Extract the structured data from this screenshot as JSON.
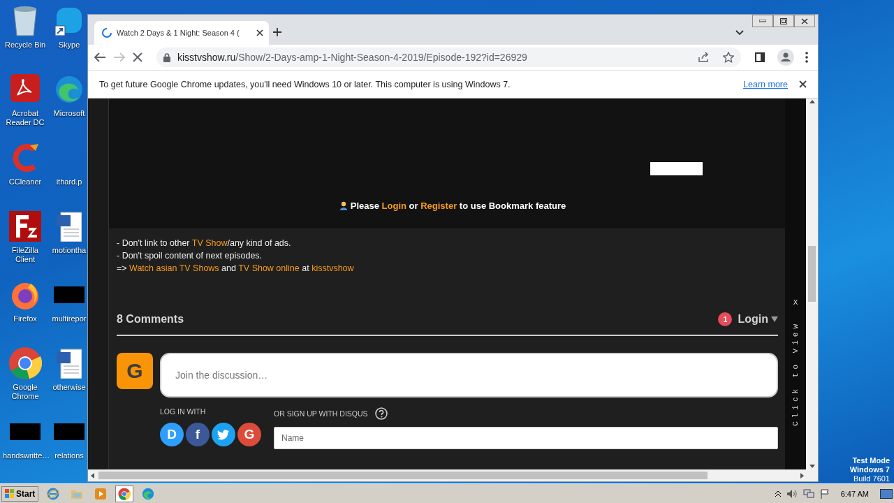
{
  "desktop": {
    "icons": [
      {
        "label": "Recycle Bin",
        "kind": "recycle"
      },
      {
        "label": "Skype",
        "kind": "skype"
      },
      {
        "label": "Acrobat Reader DC",
        "kind": "acrobat"
      },
      {
        "label": "Microsoft",
        "kind": "edge"
      },
      {
        "label": "CCleaner",
        "kind": "ccleaner"
      },
      {
        "label": "ithard.p",
        "kind": "none"
      },
      {
        "label": "FileZilla Client",
        "kind": "filezilla"
      },
      {
        "label": "motiontha",
        "kind": "word"
      },
      {
        "label": "Firefox",
        "kind": "firefox"
      },
      {
        "label": "multirepor",
        "kind": "redacted"
      },
      {
        "label": "Google Chrome",
        "kind": "chrome"
      },
      {
        "label": "otherwise",
        "kind": "word"
      },
      {
        "label": "handswritte…",
        "kind": "redacted"
      },
      {
        "label": "relations",
        "kind": "redacted"
      }
    ],
    "system_notice": [
      "Test Mode",
      "Windows 7",
      "Build 7601"
    ]
  },
  "browser": {
    "tab": {
      "title": "Watch 2 Days & 1 Night: Season 4 (",
      "loading": true
    },
    "nav": {
      "forward_disabled": true,
      "loading": true
    },
    "address": {
      "domain": "kisstvshow.ru",
      "path": "/Show/2-Days-amp-1-Night-Season-4-2019/Episode-192?id=26929"
    },
    "infobar": {
      "text": "To get future Google Chrome updates, you'll need Windows 10 or later. This computer is using Windows 7.",
      "link": "Learn more"
    },
    "page": {
      "bookmark_notice": [
        {
          "text": "Please ",
          "link": false
        },
        {
          "text": "Login",
          "link": true
        },
        {
          "text": " or ",
          "link": false
        },
        {
          "text": "Register",
          "link": true
        },
        {
          "text": " to use Bookmark feature",
          "link": false
        }
      ],
      "rules": [
        [
          {
            "text": "- Don't link to other ",
            "link": false
          },
          {
            "text": "TV Show",
            "link": true
          },
          {
            "text": "/any kind of ads.",
            "link": false
          }
        ],
        [
          {
            "text": "- Don't spoil content of next episodes.",
            "link": false
          }
        ],
        [
          {
            "text": "=> ",
            "link": false
          },
          {
            "text": "Watch asian TV Shows",
            "link": true
          },
          {
            "text": " and ",
            "link": false
          },
          {
            "text": "TV Show online",
            "link": true
          },
          {
            "text": " at ",
            "link": false
          },
          {
            "text": "kisstvshow",
            "link": true
          }
        ]
      ],
      "comments": {
        "count_label": "8 Comments",
        "notification_count": "1",
        "login_label": "Login",
        "avatar_letter": "G",
        "placeholder": "Join the discussion…",
        "login_with": "LOG IN WITH",
        "signup_label": "OR SIGN UP WITH DISQUS",
        "social": [
          {
            "kind": "disqus",
            "label": "D"
          },
          {
            "kind": "facebook",
            "label": "f"
          },
          {
            "kind": "twitter"
          },
          {
            "kind": "google",
            "label": "G"
          }
        ],
        "name_placeholder": "Name"
      },
      "side_ad": {
        "close": "X",
        "label": "Click to View"
      }
    }
  },
  "taskbar": {
    "start": "Start",
    "apps": [
      {
        "kind": "ie",
        "active": false
      },
      {
        "kind": "explorer",
        "active": false
      },
      {
        "kind": "media",
        "active": false
      },
      {
        "kind": "chrome",
        "active": true
      },
      {
        "kind": "edge",
        "active": false
      }
    ],
    "time": "6:47 AM"
  }
}
